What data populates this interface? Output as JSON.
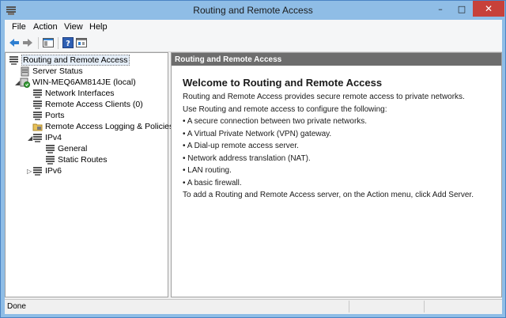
{
  "window": {
    "title": "Routing and Remote Access",
    "minimize_glyph": "–",
    "maximize_glyph": "□",
    "close_glyph": "✕"
  },
  "menu": {
    "items": [
      {
        "label": "File",
        "accel": "F"
      },
      {
        "label": "Action",
        "accel": "A"
      },
      {
        "label": "View",
        "accel": "V"
      },
      {
        "label": "Help",
        "accel": "H"
      }
    ]
  },
  "toolbar": {
    "icons": [
      "back-arrow-icon",
      "forward-arrow-icon",
      "show-hide-console-tree-icon",
      "help-icon",
      "properties-icon"
    ]
  },
  "tree": {
    "items": [
      {
        "label": "Routing and Remote Access",
        "icon": "server-icon",
        "selected": true
      },
      {
        "label": "Server Status",
        "icon": "server-status-icon"
      },
      {
        "label": "WIN-MEQ6AM814JE (local)",
        "icon": "local-server-icon",
        "expander": "◢"
      },
      {
        "label": "Network Interfaces",
        "icon": "network-interfaces-icon"
      },
      {
        "label": "Remote Access Clients (0)",
        "icon": "remote-clients-icon"
      },
      {
        "label": "Ports",
        "icon": "ports-icon"
      },
      {
        "label": "Remote Access Logging & Policies",
        "icon": "folder-icon"
      },
      {
        "label": "IPv4",
        "icon": "ipv4-icon",
        "expander": "◢"
      },
      {
        "label": "General",
        "icon": "general-icon"
      },
      {
        "label": "Static Routes",
        "icon": "static-routes-icon"
      },
      {
        "label": "IPv6",
        "icon": "ipv6-icon",
        "expander": "▷"
      }
    ]
  },
  "detail": {
    "header": "Routing and Remote Access",
    "title": "Welcome to Routing and Remote Access",
    "lines": [
      "Routing and Remote Access provides secure remote access to private networks.",
      "Use Routing and remote access to configure the following:",
      "• A secure connection between two private networks.",
      "• A Virtual Private Network (VPN) gateway.",
      "• A Dial-up remote access server.",
      "• Network address translation (NAT).",
      "• LAN routing.",
      "• A basic firewall.",
      "To add a Routing and Remote Access server, on the Action menu, click Add Server."
    ]
  },
  "status": {
    "text": "Done"
  },
  "colors": {
    "titlebar": "#8fbde6",
    "close_button": "#c7413a",
    "detail_header": "#6d6d6d",
    "selection": "#e5eef8"
  }
}
